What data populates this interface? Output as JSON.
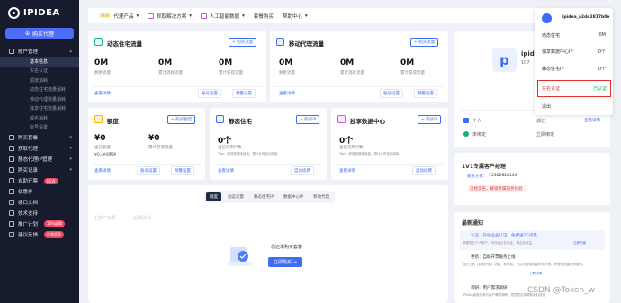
{
  "brand": {
    "name": "IPIDEA",
    "buy_label": "购买代理"
  },
  "sidebar": {
    "account": "账户管理",
    "subs": [
      "基本信息",
      "实名认证",
      "额度消耗",
      "动态住宅流量消耗",
      "移动代理流量消耗",
      "独享住宅流量消耗",
      "域名消耗",
      "账号设置"
    ],
    "groups": [
      "购买套餐",
      "获取代理",
      "静态代理IP管理",
      "购买记录",
      "自助开票",
      "优惠券",
      "接口文档",
      "技术支持",
      "推广计划",
      "建议反馈"
    ],
    "badges": {
      "invoice": "NEW",
      "promo": "10%返佣",
      "feedback": "反馈奖励"
    }
  },
  "topbar": {
    "items": [
      "代理产品",
      "抓取解决方案",
      "人工智能数据",
      "套餐购买",
      "帮助中心"
    ],
    "new_tag": "NEW"
  },
  "cards": {
    "dyn": {
      "title": "动态住宅流量",
      "buy": "+ 购买流量",
      "v1": "0M",
      "l1": "剩余流量",
      "v2": "0M",
      "l2": "累计消耗流量",
      "v3": "0M",
      "l3": "累计获得流量",
      "detail": "查看详情",
      "a1": "账号设置",
      "a2": "预警设置"
    },
    "mob": {
      "title": "移动代理流量",
      "buy": "+ 购买流量",
      "v1": "0M",
      "l1": "剩余流量",
      "v2": "0M",
      "l2": "累计消耗流量",
      "v3": "0M",
      "l3": "累计获得流量",
      "detail": "查看详情",
      "a1": "账号设置",
      "a2": "预警设置"
    },
    "quota": {
      "title": "额度",
      "buy": "+ 购买额度",
      "v1": "¥0",
      "l1": "当前额度",
      "v2": "¥0",
      "l2": "累计获得额度",
      "note": "¥0=¥0赠送",
      "detail": "查看详情",
      "a1": "账号设置",
      "a2": "预警设置"
    },
    "static": {
      "title": "静态住宅",
      "buy": "+ 购买IP",
      "v1": "0个",
      "l1": "当前可用IP数",
      "tip": "Tips：即将到期未续费，预计计时自动扣除",
      "detail": "查看详情",
      "a1": "自动续费"
    },
    "excl": {
      "title": "独享数据中心",
      "buy": "+ 购买IP",
      "v1": "0个",
      "l1": "当前可用IP数",
      "tip": "Tips：即将到期未续费，预计计时自动扣除",
      "detail": "查看详情",
      "a1": "自动续费"
    }
  },
  "tabs": [
    "额度",
    "动态流量",
    "静态住宅IP",
    "数据中心IP",
    "移动代理"
  ],
  "usage": {
    "h1": "主账户余额",
    "h2": "近期消耗"
  },
  "empty": {
    "text": "您还未购买套餐",
    "btn": "立即购买 →"
  },
  "user": {
    "name": "ipid",
    "id_prefix": "107",
    "avatar_letter": "p",
    "rows": [
      {
        "k": "个人",
        "v": "通过",
        "a": "查看详情"
      },
      {
        "k": "未绑定",
        "v": "立即绑定",
        "a": ""
      }
    ]
  },
  "manager": {
    "title": "1V1专属客户经理",
    "phone_label": "联系方式：",
    "phone": "15302828144",
    "warn": "已经实名，解锁专属服务体验"
  },
  "news": {
    "title": "最新通知",
    "items": [
      {
        "t": "认证：升级企业认证，免费送1G流量",
        "d": "恭喜您已个人用户，可升级企业认证，享企业权益。",
        "l": "立即升级"
      },
      {
        "t": "更新：自助开票服务上线",
        "d": "现已上线【自助开票】功能，即日起，可以在使用线路申请开票，享受更快捷开票服务。",
        "l": "了解详情"
      },
      {
        "t": "调研：用户需求调研",
        "d": "IPIDEA诚邀您参与用户需求调研，您的意见将帮助我们改进"
      }
    ]
  },
  "popup": {
    "username": "ipidea_a2dd2817b0e",
    "rows": [
      {
        "k": "动态住宅",
        "v": "0M"
      },
      {
        "k": "独享数据中心IP",
        "v": "0个"
      },
      {
        "k": "静态住宅IP",
        "v": "0个"
      }
    ],
    "verify": "实名认证",
    "verify_status": "已认证",
    "logout": "退出"
  },
  "watermark": "CSDN @Token_w",
  "colors": {
    "accent": "#3d6df5",
    "sidebar": "#161c2d",
    "highlight": "#e03131",
    "verified": "#1ab06b"
  }
}
